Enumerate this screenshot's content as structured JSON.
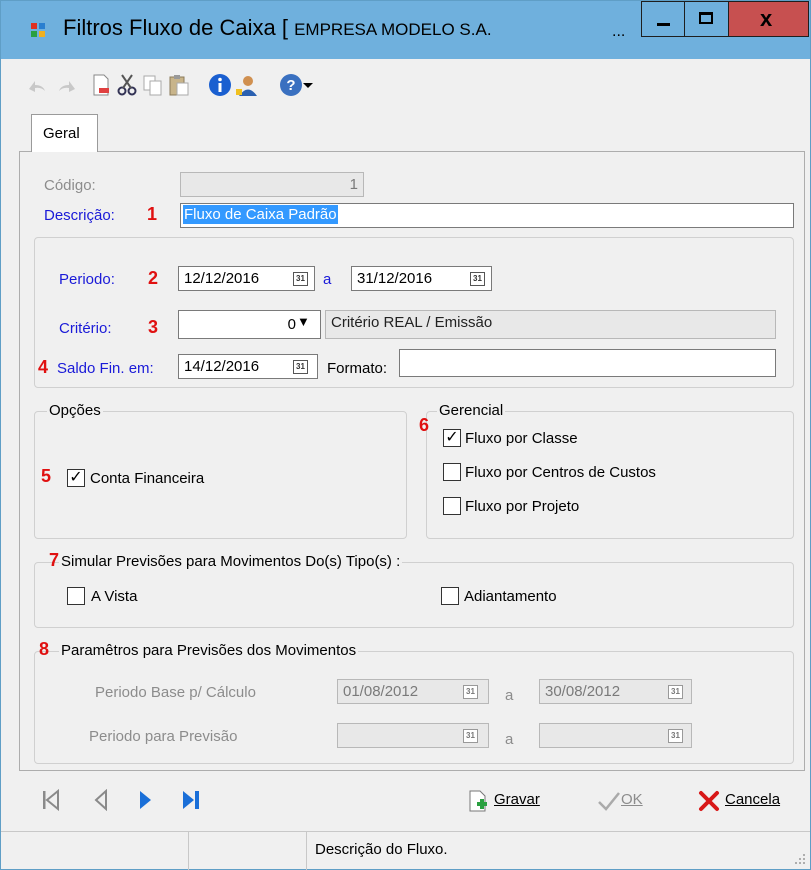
{
  "window": {
    "title": "Filtros Fluxo de Caixa [",
    "company": "EMPRESA MODELO S.A.",
    "title_more": "...",
    "close_glyph": "x"
  },
  "toolbar": {
    "icons": [
      "undo-icon",
      "redo-icon",
      "new-document-icon",
      "cut-icon",
      "copy-icon",
      "paste-icon",
      "info-icon",
      "user-icon",
      "help-icon",
      "dropdown-arrow-icon"
    ]
  },
  "tabs": [
    {
      "label": "Geral",
      "active": true
    }
  ],
  "form": {
    "codigo": {
      "label": "Código:",
      "value": "1"
    },
    "descricao": {
      "label": "Descrição:",
      "value": "Fluxo de Caixa Padrão"
    },
    "periodo": {
      "label": "Periodo:",
      "from": "12/12/2016",
      "sep": "a",
      "to": "31/12/2016"
    },
    "criterio": {
      "label": "Critério:",
      "value": "0",
      "description": "Critério REAL / Emissão"
    },
    "saldo": {
      "label": "Saldo Fin. em:",
      "value": "14/12/2016"
    },
    "formato": {
      "label": "Formato:",
      "value": ""
    }
  },
  "opcoes": {
    "title": "Opções",
    "conta_financeira": {
      "label": "Conta Financeira",
      "checked": true
    }
  },
  "gerencial": {
    "title": "Gerencial",
    "items": [
      {
        "label": "Fluxo por Classe",
        "checked": true
      },
      {
        "label": "Fluxo por Centros de Custos",
        "checked": false
      },
      {
        "label": "Fluxo por Projeto",
        "checked": false
      }
    ]
  },
  "simular": {
    "title": "Simular Previsões para Movimentos Do(s) Tipo(s) :",
    "a_vista": {
      "label": "A Vista",
      "checked": false
    },
    "adiantamento": {
      "label": "Adiantamento",
      "checked": false
    }
  },
  "parametros": {
    "title": "Paramêtros para Previsões dos Movimentos",
    "base": {
      "label": "Periodo Base p/ Cálculo",
      "from": "01/08/2012",
      "sep": "a",
      "to": "30/08/2012"
    },
    "previsao": {
      "label": "Periodo para Previsão",
      "from": "",
      "sep": "a",
      "to": ""
    }
  },
  "annotations": [
    "1",
    "2",
    "3",
    "4",
    "5",
    "6",
    "7",
    "8"
  ],
  "calendar_glyph": "31",
  "dropdown_glyph": "▼",
  "check_glyph": "✓",
  "actions": {
    "gravar": "Gravar",
    "ok": "OK",
    "cancela": "Cancela"
  },
  "status": {
    "text": "Descrição do Fluxo."
  },
  "colors": {
    "titlebar": "#6fb0dd",
    "close_button": "#c75050",
    "label_blue": "#1a1ad8",
    "annotation_red": "#e01010",
    "description_highlight": "#3399ff"
  }
}
